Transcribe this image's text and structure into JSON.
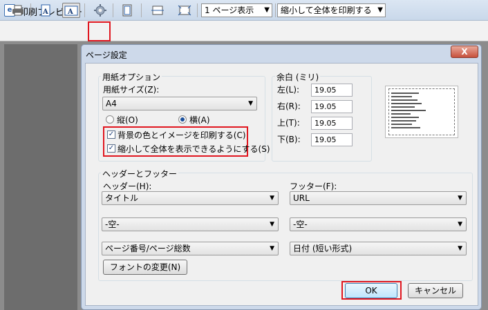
{
  "window": {
    "title": "印刷プレビュー"
  },
  "toolbar": {
    "page_view": "1 ページ表示",
    "scale": "縮小して全体を印刷する"
  },
  "dialog": {
    "title": "ページ設定",
    "close": "X",
    "paper": {
      "group_label": "用紙オプション",
      "size_label": "用紙サイズ(Z):",
      "size_value": "A4",
      "portrait": "縦(O)",
      "landscape": "横(A)",
      "orientation_selected": "landscape",
      "print_bg": "背景の色とイメージを印刷する(C)",
      "print_bg_checked": true,
      "shrink": "縮小して全体を表示できるようにする(S)",
      "shrink_checked": true
    },
    "margins": {
      "group_label": "余白 (ミリ)",
      "left_label": "左(L):",
      "left": "19.05",
      "right_label": "右(R):",
      "right": "19.05",
      "top_label": "上(T):",
      "top": "19.05",
      "bottom_label": "下(B):",
      "bottom": "19.05"
    },
    "header_footer": {
      "group_label": "ヘッダーとフッター",
      "header_label": "ヘッダー(H):",
      "footer_label": "フッター(F):",
      "header1": "タイトル",
      "header2": "-空-",
      "header3": "ページ番号/ページ総数",
      "footer1": "URL",
      "footer2": "-空-",
      "footer3": "日付 (短い形式)",
      "font_button": "フォントの変更(N)"
    },
    "ok": "OK",
    "cancel": "キャンセル"
  },
  "colors": {
    "highlight": "#e0161f",
    "accent": "#1a4f9c"
  }
}
